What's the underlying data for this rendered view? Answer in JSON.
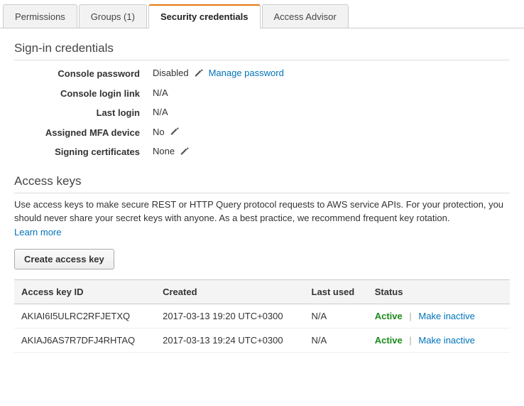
{
  "tabs": {
    "permissions": "Permissions",
    "groups": "Groups (1)",
    "security": "Security credentials",
    "advisor": "Access Advisor"
  },
  "signin": {
    "title": "Sign-in credentials",
    "rows": {
      "console_password": {
        "label": "Console password",
        "value": "Disabled",
        "link": "Manage password"
      },
      "console_login_link": {
        "label": "Console login link",
        "value": "N/A"
      },
      "last_login": {
        "label": "Last login",
        "value": "N/A"
      },
      "mfa": {
        "label": "Assigned MFA device",
        "value": "No"
      },
      "signing_certs": {
        "label": "Signing certificates",
        "value": "None"
      }
    }
  },
  "access_keys": {
    "title": "Access keys",
    "description": "Use access keys to make secure REST or HTTP Query protocol requests to AWS service APIs. For your protection, you should never share your secret keys with anyone. As a best practice, we recommend frequent key rotation.",
    "learn_more": "Learn more",
    "create_button": "Create access key",
    "columns": {
      "id": "Access key ID",
      "created": "Created",
      "last_used": "Last used",
      "status": "Status"
    },
    "rows": [
      {
        "id": "AKIAI6I5ULRC2RFJETXQ",
        "created": "2017-03-13 19:20 UTC+0300",
        "last_used": "N/A",
        "status": "Active",
        "action": "Make inactive"
      },
      {
        "id": "AKIAJ6AS7R7DFJ4RHTAQ",
        "created": "2017-03-13 19:24 UTC+0300",
        "last_used": "N/A",
        "status": "Active",
        "action": "Make inactive"
      }
    ]
  }
}
